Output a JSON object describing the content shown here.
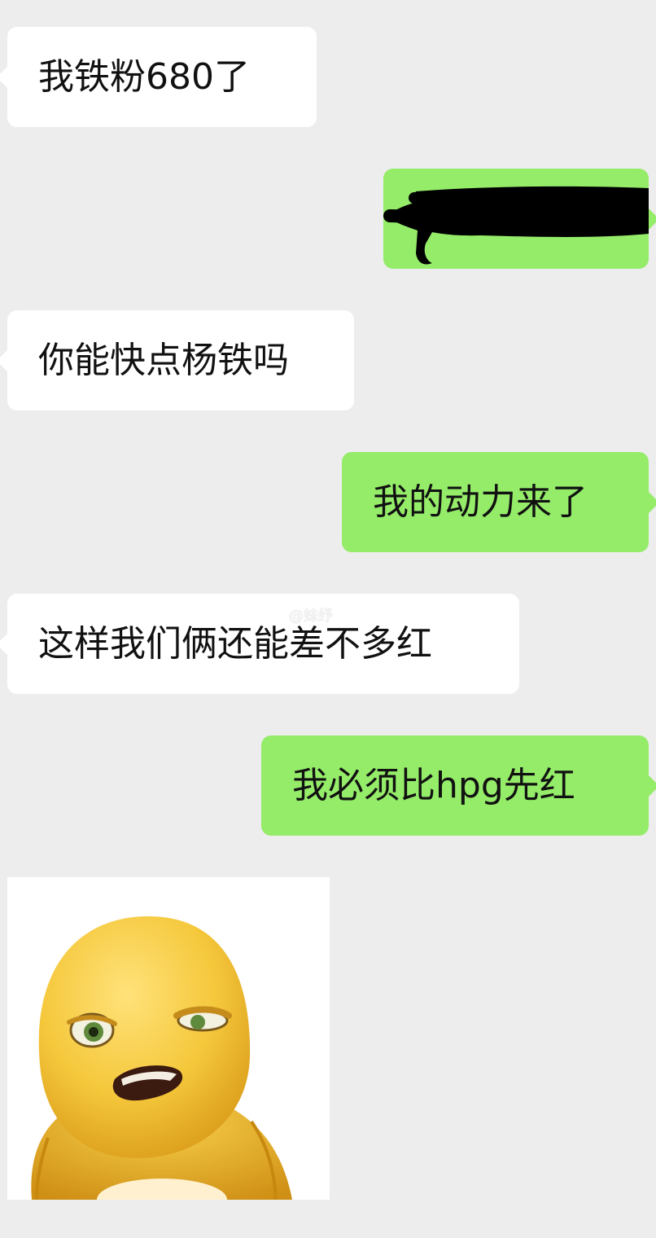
{
  "conversation": {
    "messages": [
      {
        "sender": "other",
        "text": "我铁粉680了"
      },
      {
        "sender": "me",
        "text": "",
        "note": "redacted"
      },
      {
        "sender": "other",
        "text": "你能快点杨铁吗"
      },
      {
        "sender": "me",
        "text": "我的动力来了"
      },
      {
        "sender": "other",
        "text": "这样我们俩还能差不多红"
      },
      {
        "sender": "me",
        "text": "我必须比hpg先红"
      }
    ],
    "sticker": {
      "icon": "yellow-cartoon-face-sticker-icon"
    }
  },
  "watermark": {
    "text": "@妹纾"
  },
  "colors": {
    "background": "#ededed",
    "incoming_bubble": "#ffffff",
    "outgoing_bubble": "#95ec69",
    "text": "#111111",
    "redaction": "#000000"
  }
}
